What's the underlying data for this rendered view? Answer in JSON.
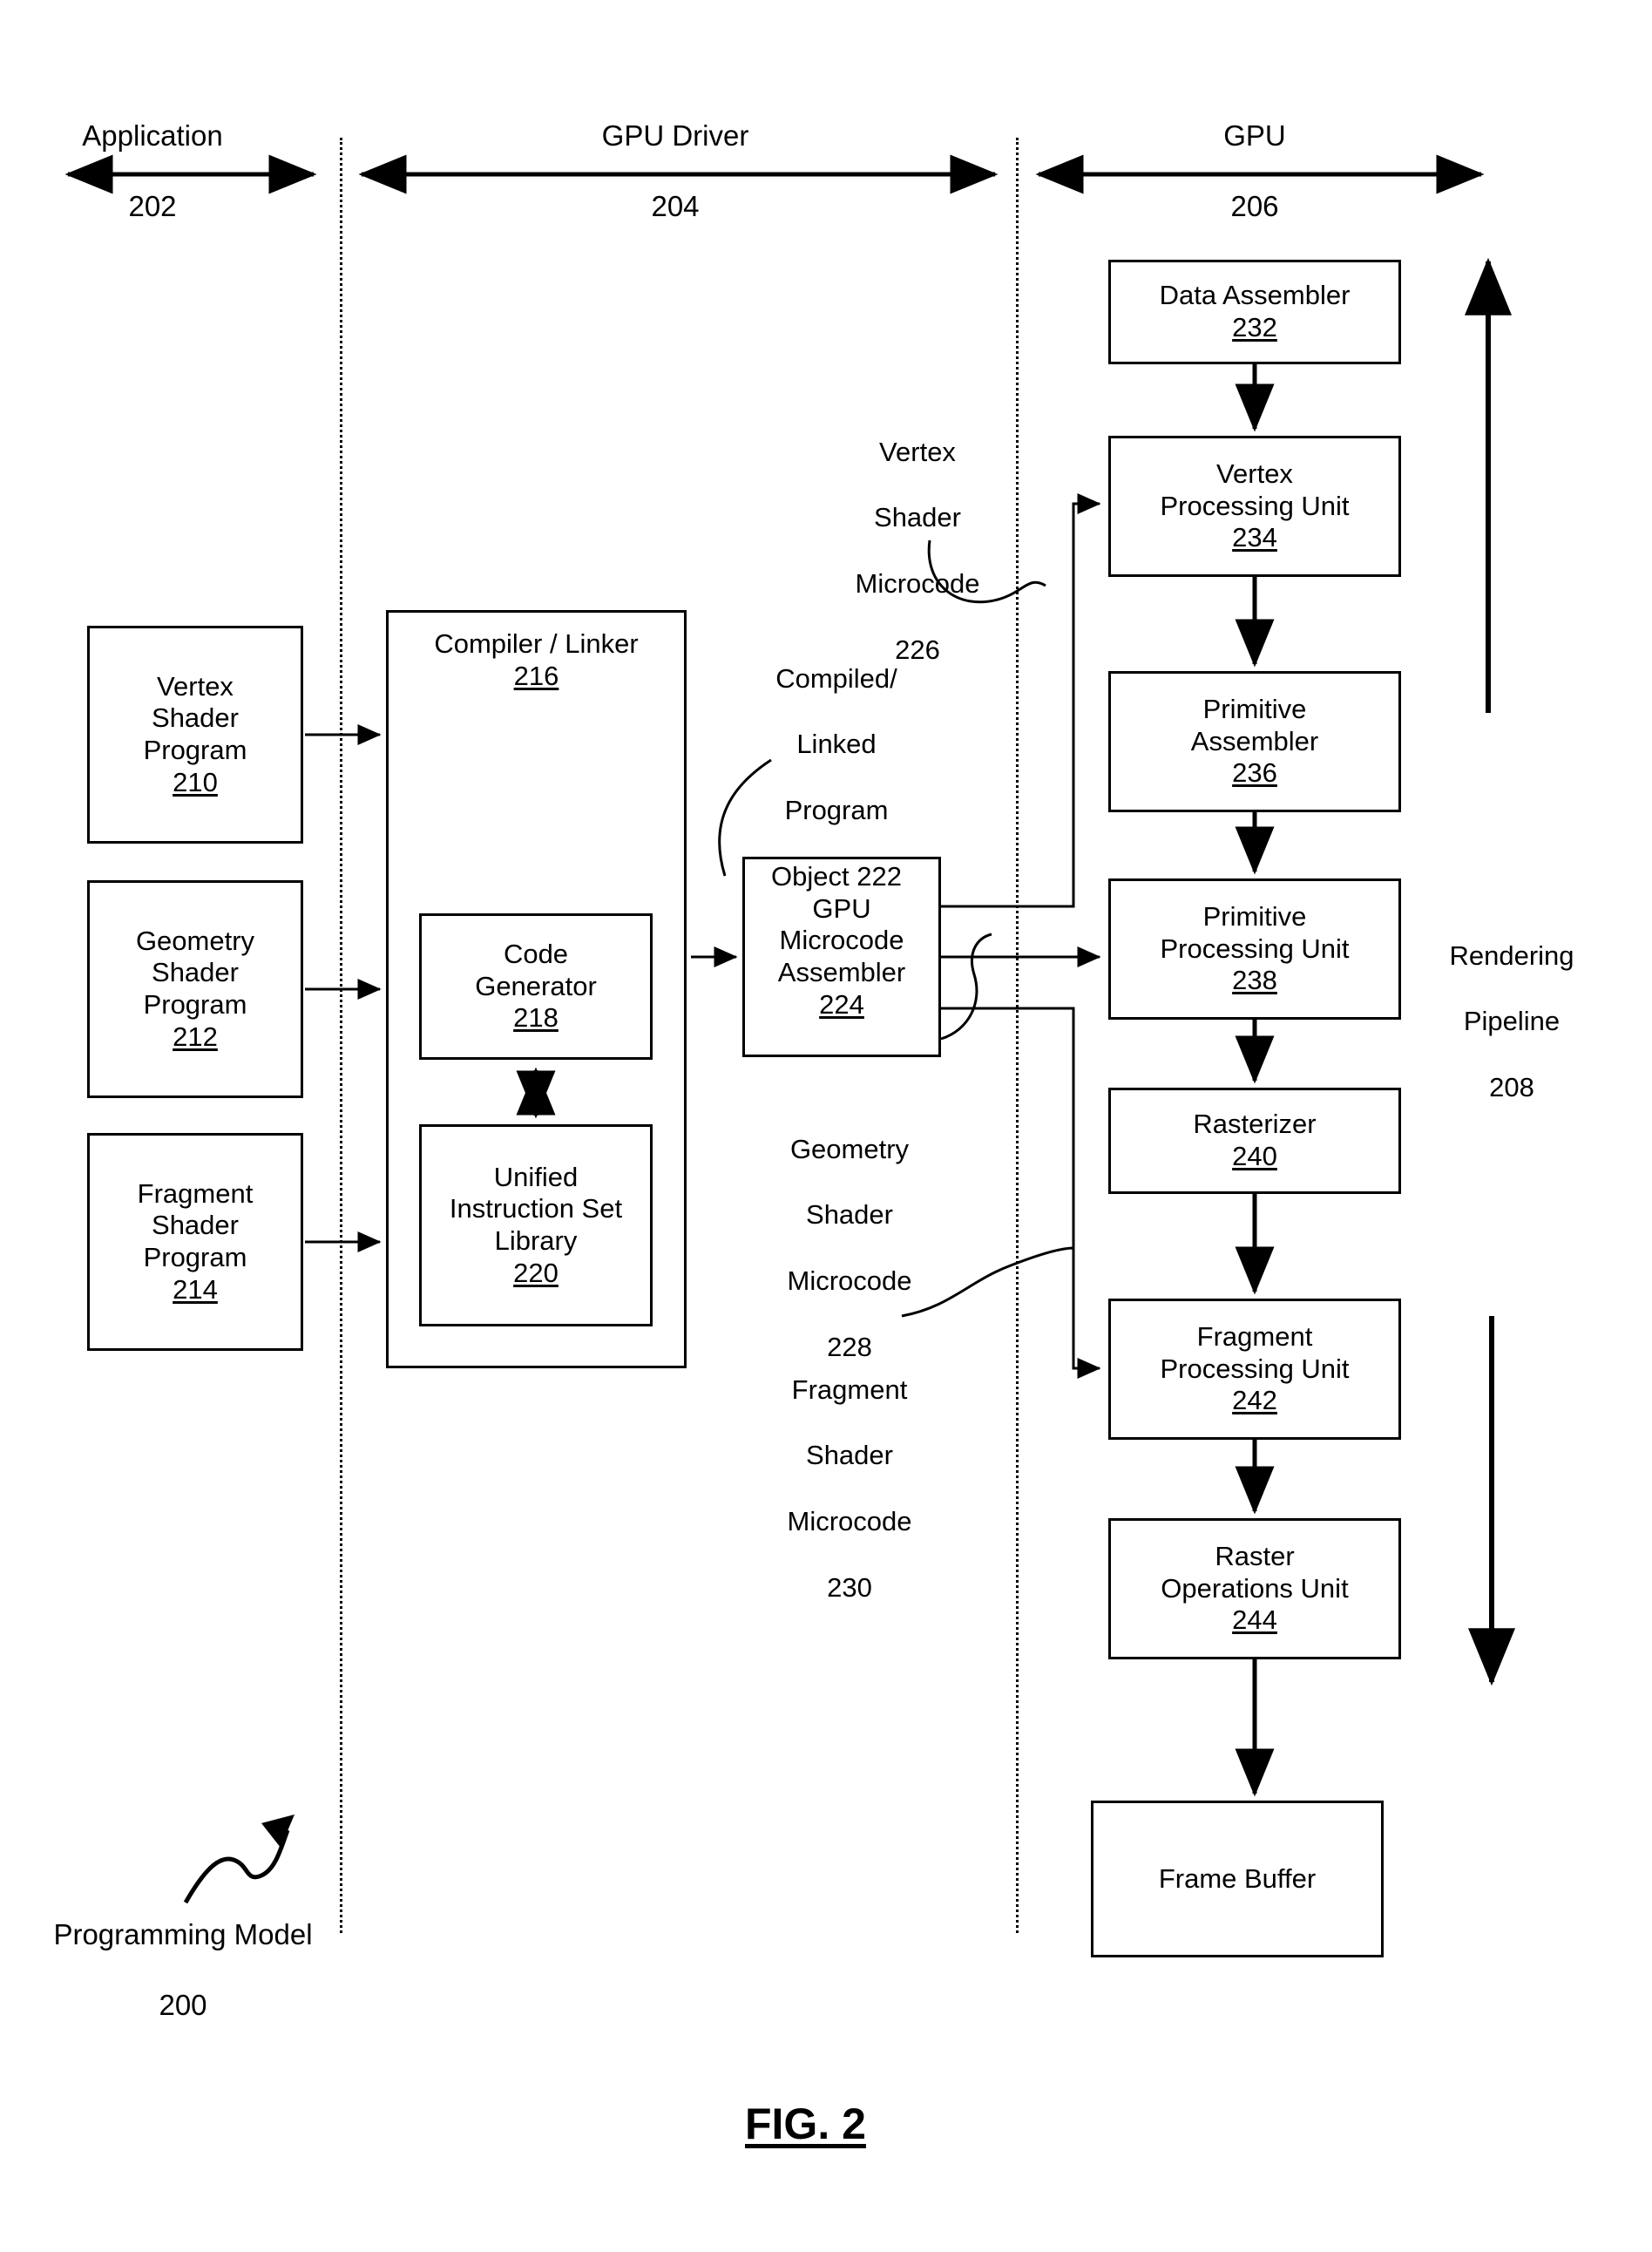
{
  "figure": {
    "caption": "FIG. 2",
    "overall_label": {
      "line1": "Programming Model",
      "line2": "200"
    }
  },
  "columns": [
    {
      "name": "application",
      "title": "Application",
      "number": "202"
    },
    {
      "name": "gpu-driver",
      "title": "GPU Driver",
      "number": "204"
    },
    {
      "name": "gpu",
      "title": "GPU",
      "number": "206"
    }
  ],
  "application_blocks": [
    {
      "name": "vertex-shader-program",
      "lines": [
        "Vertex",
        "Shader",
        "Program"
      ],
      "number": "210"
    },
    {
      "name": "geometry-shader-program",
      "lines": [
        "Geometry",
        "Shader",
        "Program"
      ],
      "number": "212"
    },
    {
      "name": "fragment-shader-program",
      "lines": [
        "Fragment",
        "Shader",
        "Program"
      ],
      "number": "214"
    }
  ],
  "driver_blocks": {
    "compiler_linker": {
      "lines": [
        "Compiler / Linker"
      ],
      "number": "216"
    },
    "code_generator": {
      "lines": [
        "Code",
        "Generator"
      ],
      "number": "218"
    },
    "unified_instruction_set_library": {
      "lines": [
        "Unified",
        "Instruction Set",
        "Library"
      ],
      "number": "220"
    },
    "gpu_microcode_assembler": {
      "lines": [
        "GPU",
        "Microcode",
        "Assembler"
      ],
      "number": "224"
    }
  },
  "driver_labels": {
    "compiled_linked_program_object": {
      "lines": [
        "Compiled/",
        "Linked",
        "Program",
        "Object 222"
      ]
    },
    "vertex_shader_microcode": {
      "lines": [
        "Vertex",
        "Shader",
        "Microcode",
        "226"
      ]
    },
    "geometry_shader_microcode": {
      "lines": [
        "Geometry",
        "Shader",
        "Microcode",
        "228"
      ]
    },
    "fragment_shader_microcode": {
      "lines": [
        "Fragment",
        "Shader",
        "Microcode",
        "230"
      ]
    }
  },
  "gpu_blocks": [
    {
      "name": "data-assembler",
      "lines": [
        "Data Assembler"
      ],
      "number": "232"
    },
    {
      "name": "vertex-processing-unit",
      "lines": [
        "Vertex",
        "Processing Unit"
      ],
      "number": "234"
    },
    {
      "name": "primitive-assembler",
      "lines": [
        "Primitive",
        "Assembler"
      ],
      "number": "236"
    },
    {
      "name": "primitive-processing-unit",
      "lines": [
        "Primitive",
        "Processing Unit"
      ],
      "number": "238"
    },
    {
      "name": "rasterizer",
      "lines": [
        "Rasterizer"
      ],
      "number": "240"
    },
    {
      "name": "fragment-processing-unit",
      "lines": [
        "Fragment",
        "Processing Unit"
      ],
      "number": "242"
    },
    {
      "name": "raster-operations-unit",
      "lines": [
        "Raster",
        "Operations Unit"
      ],
      "number": "244"
    },
    {
      "name": "frame-buffer",
      "lines": [
        "Frame Buffer"
      ],
      "number": ""
    }
  ],
  "gpu_labels": {
    "rendering_pipeline": {
      "lines": [
        "Rendering",
        "Pipeline",
        "208"
      ]
    }
  },
  "colors": {
    "stroke": "#000000",
    "background": "#ffffff"
  }
}
